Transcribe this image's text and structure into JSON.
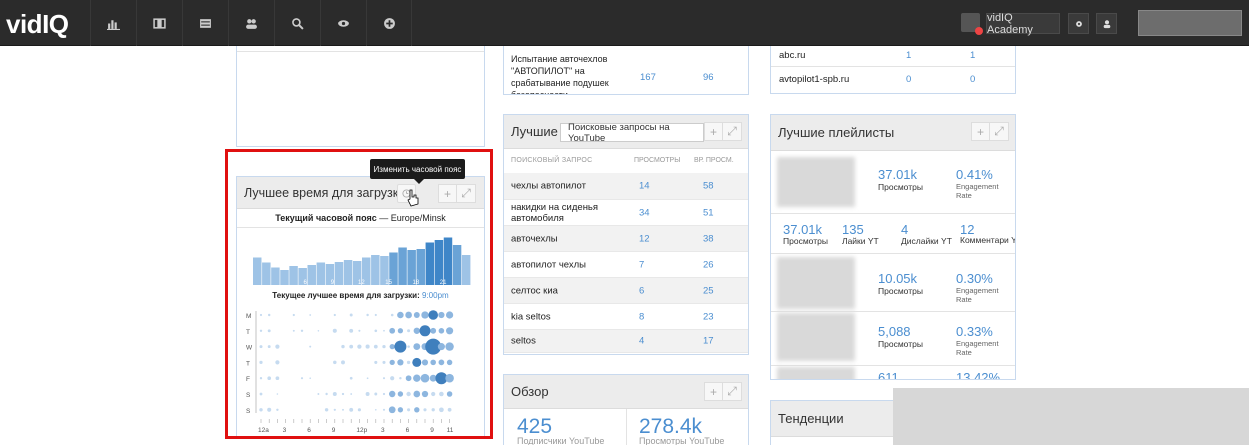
{
  "header": {
    "logo": "vidIQ",
    "nav_icons": [
      "chart-icon",
      "film-icon",
      "list-icon",
      "users-icon",
      "search-icon",
      "eye-icon",
      "plus-circle-icon"
    ],
    "academy_label": "vidIQ Academy"
  },
  "panel_top_mid": {
    "row_title": "Испытание авточехлов \"АВТОПИЛОТ\" на срабатывание подушек безопасности",
    "row_views": "167",
    "row_watch": "96"
  },
  "panel_top_right": {
    "rows": [
      {
        "site": "abc.ru",
        "a": "1",
        "b": "1"
      },
      {
        "site": "avtopilot1-spb.ru",
        "a": "0",
        "b": "0"
      }
    ]
  },
  "tooltip": "Изменить часовой пояс",
  "best_time": {
    "title": "Лучшее время для загрузки",
    "tz_label": "Текущий часовой пояс",
    "tz_sep": " — ",
    "tz_value": "Europe/Minsk",
    "best_label": "Текущее лучшее время для загрузки:",
    "best_value": "9:00pm",
    "bar_labels": [
      "6",
      "9",
      "12",
      "15",
      "18",
      "21"
    ],
    "bar_values": [
      0.55,
      0.45,
      0.35,
      0.3,
      0.38,
      0.34,
      0.4,
      0.45,
      0.42,
      0.46,
      0.5,
      0.48,
      0.55,
      0.6,
      0.58,
      0.65,
      0.75,
      0.7,
      0.72,
      0.85,
      0.9,
      0.95,
      0.8,
      0.6
    ],
    "days": [
      "M",
      "T",
      "W",
      "T",
      "F",
      "S",
      "S"
    ],
    "hour_ticks": [
      "12a",
      "3",
      "6",
      "9",
      "12p",
      "3",
      "6",
      "9",
      "11"
    ]
  },
  "best_queries": {
    "title": "Лучшие",
    "select": "Поисковые запросы на YouTube",
    "headers": [
      "ПОИСКОВЫЙ ЗАПРОС",
      "ПРОСМОТРЫ",
      "ВР. ПРОСМ."
    ],
    "rows": [
      {
        "q": "чехлы автопилот",
        "v": "14",
        "w": "58"
      },
      {
        "q": "накидки на сиденья автомобиля",
        "v": "34",
        "w": "51"
      },
      {
        "q": "авточехлы",
        "v": "12",
        "w": "38"
      },
      {
        "q": "автопилот чехлы",
        "v": "7",
        "w": "26"
      },
      {
        "q": "селтос киа",
        "v": "6",
        "w": "25"
      },
      {
        "q": "kia seltos",
        "v": "8",
        "w": "23"
      },
      {
        "q": "seltos",
        "v": "4",
        "w": "17"
      }
    ]
  },
  "overview": {
    "title": "Обзор",
    "subs_value": "425",
    "subs_label": "Подписчики YouTube",
    "views_value": "278.4k",
    "views_label": "Просмотры YouTube"
  },
  "playlists": {
    "title": "Лучшие плейлисты",
    "row1": {
      "views": "37.01k",
      "views_label": "Просмотры",
      "eng": "0.41%",
      "eng_label": "Engagement Rate"
    },
    "stats": [
      {
        "value": "37.01k",
        "label": "Просмотры"
      },
      {
        "value": "135",
        "label": "Лайки YT"
      },
      {
        "value": "4",
        "label": "Дислайки YT"
      },
      {
        "value": "12",
        "label": "Комментари YT"
      }
    ],
    "row2": {
      "views": "10.05k",
      "views_label": "Просмотры",
      "eng": "0.30%",
      "eng_label": "Engagement Rate"
    },
    "row3": {
      "views": "5,088",
      "views_label": "Просмотры",
      "eng": "0.33%",
      "eng_label": "Engagement Rate"
    },
    "row4": {
      "views": "611",
      "eng": "13.42%"
    }
  },
  "trends": {
    "title": "Тенденции"
  }
}
